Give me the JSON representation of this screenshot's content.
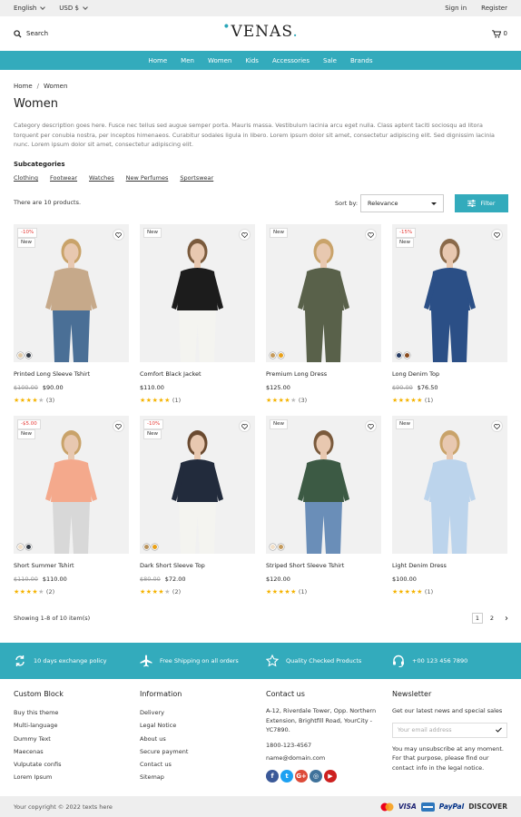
{
  "topbar": {
    "language": "English",
    "currency": "USD $",
    "signin": "Sign in",
    "register": "Register"
  },
  "header": {
    "search_label": "Search",
    "logo": "VENAS",
    "cart_count": "0"
  },
  "nav": [
    "Home",
    "Men",
    "Women",
    "Kids",
    "Accessories",
    "Sale",
    "Brands"
  ],
  "breadcrumb": {
    "home": "Home",
    "current": "Women"
  },
  "page_title": "Women",
  "description": "Category description goes here. Fusce nec tellus sed augue semper porta. Mauris massa. Vestibulum lacinia arcu eget nulla. Class aptent taciti sociosqu ad litora torquent per conubia nostra, per inceptos himenaeos. Curabitur sodales ligula in libero. Lorem ipsum dolor sit amet, consectetur adipiscing elit. Sed dignissim lacinia nunc. Lorem ipsum dolor sit amet, consectetur adipiscing elit.",
  "subcategories": {
    "heading": "Subcategories",
    "items": [
      "Clothing",
      "Footwear",
      "Watches",
      "New Perfumes",
      "Sportswear"
    ]
  },
  "listing": {
    "count_text": "There are 10 products.",
    "sort_label": "Sort by:",
    "sort_value": "Relevance",
    "filter_label": "Filter"
  },
  "products": [
    {
      "name": "Printed Long Sleeve Tshirt",
      "old_price": "$100.00",
      "price": "$90.00",
      "discount": "-10%",
      "new": "New",
      "rating": 4,
      "reviews": "(3)",
      "swatches": [
        "#e0c9a6",
        "#333a44"
      ],
      "colors": {
        "top": "#c6a98a",
        "bottom": "#4a6f96",
        "skin": "#e8c8b0",
        "hair": "#c9a36a"
      }
    },
    {
      "name": "Comfort Black Jacket",
      "old_price": "",
      "price": "$110.00",
      "discount": "",
      "new": "New",
      "rating": 5,
      "reviews": "(1)",
      "swatches": [],
      "colors": {
        "top": "#1c1c1c",
        "bottom": "#f4f4f0",
        "skin": "#e8c8b0",
        "hair": "#7a5a3c"
      }
    },
    {
      "name": "Premium Long Dress",
      "old_price": "",
      "price": "$125.00",
      "discount": "",
      "new": "New",
      "rating": 4,
      "reviews": "(3)",
      "swatches": [
        "#c49a5c",
        "#e8a018"
      ],
      "colors": {
        "top": "#59614a",
        "bottom": "#59614a",
        "skin": "#e8c8b0",
        "hair": "#c9a36a"
      }
    },
    {
      "name": "Long Denim Top",
      "old_price": "$90.00",
      "price": "$76.50",
      "discount": "-15%",
      "new": "New",
      "rating": 5,
      "reviews": "(1)",
      "swatches": [
        "#253b63",
        "#8a4b1e"
      ],
      "colors": {
        "top": "#2b4f86",
        "bottom": "#2b4f86",
        "skin": "#e8c8b0",
        "hair": "#8a6a4a"
      }
    },
    {
      "name": "Short Summer Tshirt",
      "old_price": "$110.00",
      "price": "$110.00",
      "discount": "-$5.00",
      "new": "New",
      "rating": 4,
      "reviews": "(2)",
      "swatches": [
        "#f1dfc8",
        "#333a44"
      ],
      "colors": {
        "top": "#f4a98c",
        "bottom": "#d8d8d8",
        "skin": "#e8c8b0",
        "hair": "#c9a36a"
      }
    },
    {
      "name": "Dark Short Sleeve Top",
      "old_price": "$80.00",
      "price": "$72.00",
      "discount": "-10%",
      "new": "New",
      "rating": 4,
      "reviews": "(2)",
      "swatches": [
        "#b8925c",
        "#e8a018"
      ],
      "colors": {
        "top": "#222b3c",
        "bottom": "#f4f4f0",
        "skin": "#e8c8b0",
        "hair": "#6a4a30"
      }
    },
    {
      "name": "Striped Short Sleeve Tshirt",
      "old_price": "",
      "price": "$120.00",
      "discount": "",
      "new": "New",
      "rating": 5,
      "reviews": "(1)",
      "swatches": [
        "#f1dfc8",
        "#c49a5c"
      ],
      "colors": {
        "top": "#3c5a44",
        "bottom": "#6a8eb8",
        "skin": "#e8c8b0",
        "hair": "#7a5a3c"
      }
    },
    {
      "name": "Light Denim Dress",
      "old_price": "",
      "price": "$100.00",
      "discount": "",
      "new": "New",
      "rating": 5,
      "reviews": "(1)",
      "swatches": [],
      "colors": {
        "top": "#bcd4ec",
        "bottom": "#bcd4ec",
        "skin": "#e8c8b0",
        "hair": "#c9a36a"
      }
    }
  ],
  "pagination": {
    "showing": "Showing 1-8 of 10 item(s)",
    "pages": [
      "1",
      "2"
    ],
    "next": "›"
  },
  "features": [
    "10 days exchange policy",
    "Free Shipping on all orders",
    "Quality Checked Products",
    "+00 123 456 7890"
  ],
  "footer": {
    "custom": {
      "title": "Custom Block",
      "items": [
        "Buy this theme",
        "Multi-language",
        "Dummy Text",
        "Maecenas",
        "Vulputate confis",
        "Lorem Ipsum"
      ]
    },
    "info": {
      "title": "Information",
      "items": [
        "Delivery",
        "Legal Notice",
        "About us",
        "Secure payment",
        "Contact us",
        "Sitemap"
      ]
    },
    "contact": {
      "title": "Contact us",
      "address": "A-12, Riverdale Tower, Opp. Northern Extension, Brightfill Road, YourCity - YC7890.",
      "phone": "1800-123-4567",
      "email": "name@domain.com"
    },
    "newsletter": {
      "title": "Newsletter",
      "lead": "Get our latest news and special sales",
      "placeholder": "Your email address",
      "note": "You may unsubscribe at any moment. For that purpose, please find our contact info in the legal notice."
    },
    "social": [
      {
        "name": "facebook",
        "glyph": "f",
        "color": "#3b5998"
      },
      {
        "name": "twitter",
        "glyph": "t",
        "color": "#1da1f2"
      },
      {
        "name": "google-plus",
        "glyph": "G+",
        "color": "#dd4b39"
      },
      {
        "name": "instagram",
        "glyph": "◎",
        "color": "#3f729b"
      },
      {
        "name": "youtube",
        "glyph": "▶",
        "color": "#cd201f"
      }
    ]
  },
  "copyright": "Your copyright © 2022 texts here",
  "payments": [
    "VISA",
    "PayPal",
    "DISCOVER"
  ],
  "colors": {
    "accent": "#33abbc",
    "discount": "#e53935",
    "star": "#f5b301"
  }
}
